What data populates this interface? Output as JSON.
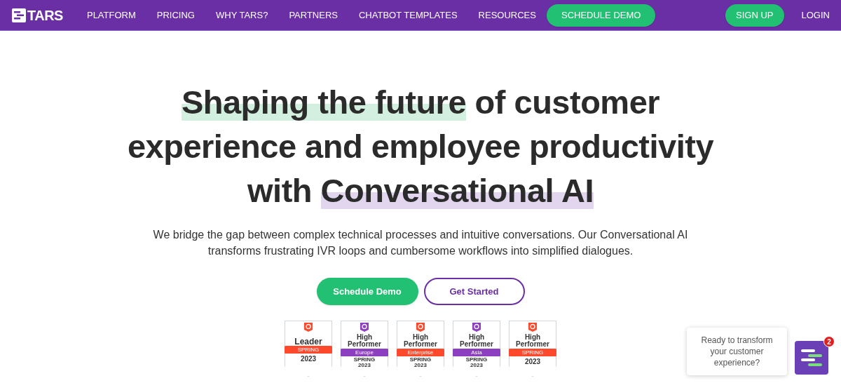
{
  "nav": {
    "logo": "TARS",
    "items": [
      {
        "label": "PLATFORM",
        "kind": "link"
      },
      {
        "label": "PRICING",
        "kind": "link"
      },
      {
        "label": "WHY TARS?",
        "kind": "link"
      },
      {
        "label": "PARTNERS",
        "kind": "link"
      },
      {
        "label": "CHATBOT TEMPLATES",
        "kind": "link"
      },
      {
        "label": "RESOURCES",
        "kind": "link"
      },
      {
        "label": "SCHEDULE DEMO",
        "kind": "button"
      }
    ],
    "right": [
      {
        "label": "SIGN UP",
        "kind": "button"
      },
      {
        "label": "LOGIN",
        "kind": "link"
      }
    ]
  },
  "headline": [
    [
      {
        "text": "Shaping the future",
        "highlighted": true,
        "color": "#d3efe0"
      },
      {
        "text": " of customer",
        "highlighted": false
      }
    ],
    [
      {
        "text": "experience and employee productivity",
        "highlighted": false
      }
    ],
    [
      {
        "text": "with ",
        "highlighted": false
      },
      {
        "text": "Conversational AI",
        "highlighted": true,
        "color": "#e2d6ee"
      }
    ]
  ],
  "subtitle": "We bridge the gap between complex technical processes and intuitive conversations. Our Conversational AI transforms frustrating IVR loops and cumbersome workflows into simplified dialogues.",
  "buttons": [
    {
      "label": "Schedule Demo",
      "kind": "primary"
    },
    {
      "label": "Get Started",
      "kind": "outline"
    }
  ],
  "badges": [
    {
      "title": [
        "Leader"
      ],
      "ribbon": "SPRING",
      "color": "#ff492c",
      "footer": [
        "2023"
      ]
    },
    {
      "title": [
        "High",
        "Performer"
      ],
      "ribbon": "Europe",
      "color": "#8c3fbf",
      "footer": [
        "SPRING",
        "2023"
      ]
    },
    {
      "title": [
        "High",
        "Performer"
      ],
      "ribbon": "Enterprise",
      "color": "#ff492c",
      "footer": [
        "SPRING",
        "2023"
      ]
    },
    {
      "title": [
        "High",
        "Performer"
      ],
      "ribbon": "Asia",
      "color": "#8c3fbf",
      "footer": [
        "SPRING",
        "2023"
      ]
    },
    {
      "title": [
        "High",
        "Performer"
      ],
      "ribbon": "SPRING",
      "color": "#ff492c",
      "footer": [
        "2023"
      ]
    }
  ],
  "chat": {
    "message": "Ready to transform your customer experience?",
    "count": "2"
  }
}
